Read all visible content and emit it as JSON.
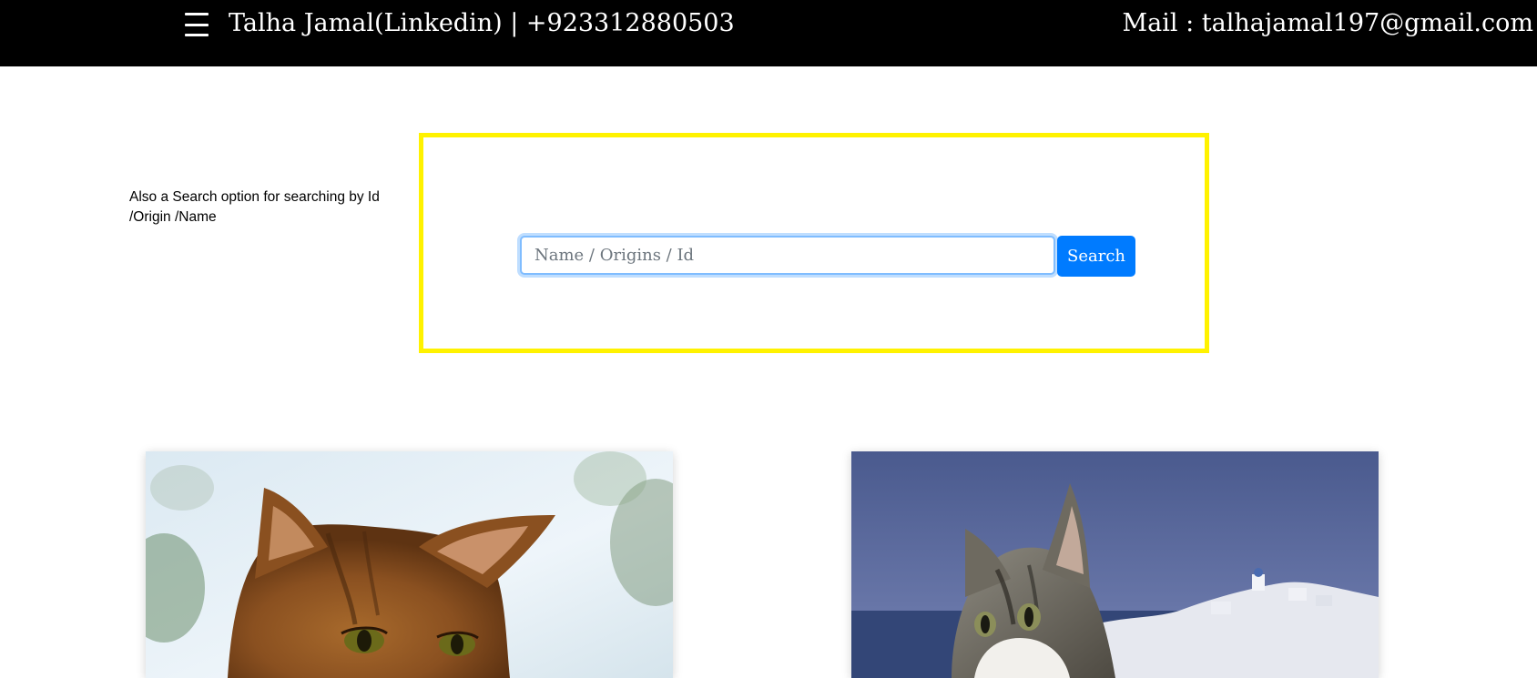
{
  "header": {
    "brand": "Talha Jamal(Linkedin) | +923312880503",
    "mail": "Mail : talhajamal197@gmail.com",
    "menu_icon": "hamburger-menu-icon"
  },
  "note": {
    "text": "Also a Search option for searching by Id /Origin /Name"
  },
  "search": {
    "placeholder": "Name / Origins / Id",
    "value": "",
    "button_label": "Search"
  },
  "colors": {
    "header_bg": "#000000",
    "highlight_border": "#fff200",
    "button_bg": "#007bff",
    "input_focus_border": "#80bdff"
  },
  "cards": [
    {
      "image": "abyssinian-cat-photo"
    },
    {
      "image": "tabby-kitten-coastal-town-photo"
    }
  ]
}
